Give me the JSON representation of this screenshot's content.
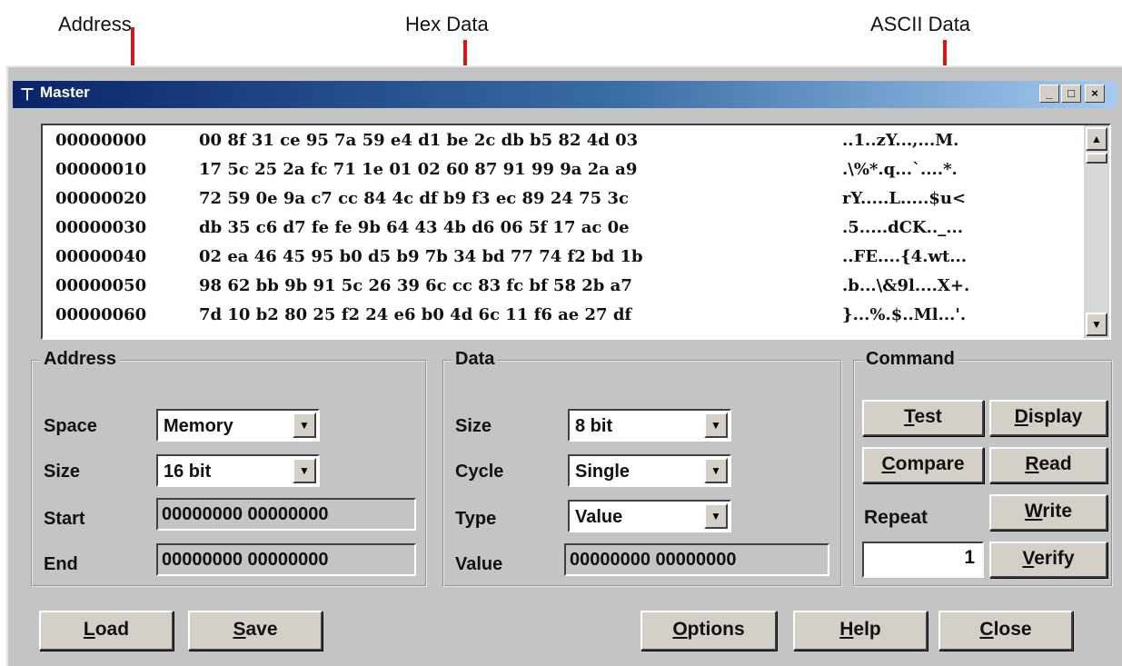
{
  "annotations": {
    "address": "Address",
    "hex": "Hex Data",
    "ascii": "ASCII Data"
  },
  "window": {
    "title": "Master",
    "title_icon": "pin-icon",
    "buttons": [
      "_",
      "□",
      "×"
    ]
  },
  "dump": {
    "rows": [
      {
        "addr": "00000000",
        "hex": "00 8f 31 ce 95 7a 59 e4 d1 be 2c db b5 82 4d 03",
        "ascii": "..1..zY...,...M."
      },
      {
        "addr": "00000010",
        "hex": "17 5c 25 2a fc 71 1e 01 02 60 87 91 99 9a 2a a9",
        "ascii": ".\\%*.q...`....*."
      },
      {
        "addr": "00000020",
        "hex": "72 59 0e 9a c7 cc 84 4c df b9 f3 ec 89 24 75 3c",
        "ascii": "rY.....L.....$u<"
      },
      {
        "addr": "00000030",
        "hex": "db 35 c6 d7 fe fe 9b 64 43 4b d6 06 5f 17 ac 0e",
        "ascii": ".5.....dCK.._..."
      },
      {
        "addr": "00000040",
        "hex": "02 ea 46 45 95 b0 d5 b9 7b 34 bd 77 74 f2 bd 1b",
        "ascii": "..FE....{4.wt..."
      },
      {
        "addr": "00000050",
        "hex": "98 62 bb 9b 91 5c 26 39 6c cc 83 fc bf 58 2b a7",
        "ascii": ".b...\\&9l....X+."
      },
      {
        "addr": "00000060",
        "hex": "7d 10 b2 80 25 f2 24 e6 b0 4d 6c 11 f6 ae 27 df",
        "ascii": "}...%.$..Ml...'."
      }
    ]
  },
  "address_group": {
    "title": "Address",
    "space_label": "Space",
    "space_value": "Memory",
    "size_label": "Size",
    "size_value": "16 bit",
    "start_label": "Start",
    "start_value": "00000000 00000000",
    "end_label": "End",
    "end_value": "00000000 00000000"
  },
  "data_group": {
    "title": "Data",
    "size_label": "Size",
    "size_value": "8 bit",
    "cycle_label": "Cycle",
    "cycle_value": "Single",
    "type_label": "Type",
    "type_value": "Value",
    "value_label": "Value",
    "value_value": "00000000 00000000"
  },
  "command_group": {
    "title": "Command",
    "test": {
      "mn": "T",
      "rest": "est"
    },
    "display": {
      "mn": "D",
      "rest": "isplay"
    },
    "compare": {
      "mn": "C",
      "rest": "ompare"
    },
    "read": {
      "mn": "R",
      "rest": "ead"
    },
    "repeat_label": "Repeat",
    "write": {
      "mn": "W",
      "rest": "rite"
    },
    "repeat_value": "1",
    "verify": {
      "mn": "V",
      "rest": "erify"
    }
  },
  "bottom_buttons": {
    "load": {
      "mn": "L",
      "rest": "oad"
    },
    "save": {
      "mn": "S",
      "rest": "ave"
    },
    "options": {
      "mn": "O",
      "rest": "ptions"
    },
    "help": {
      "mn": "H",
      "rest": "elp"
    },
    "close": {
      "mn": "C",
      "rest": "lose"
    }
  },
  "colors": {
    "annotation_line": "#d41818",
    "titlebar_start": "#0a246a",
    "titlebar_end": "#a6caf0",
    "window_bg": "#c4c4c4"
  }
}
